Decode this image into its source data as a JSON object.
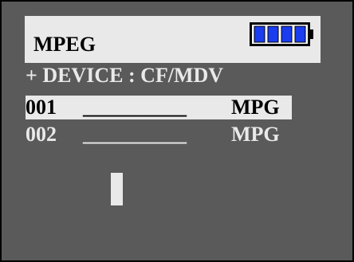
{
  "header": {
    "title": "MPEG",
    "battery_icon": "battery-full-icon",
    "battery_level": 1.0,
    "battery_color": "#1a3df0"
  },
  "device": {
    "label": "+ DEVICE : CF/MDV"
  },
  "files": [
    {
      "number": "001",
      "name": "__________",
      "extension": "MPG",
      "selected": true
    },
    {
      "number": "002",
      "name": "__________",
      "extension": "MPG",
      "selected": false
    }
  ],
  "colors": {
    "screen_background": "#5a5a5a",
    "highlight": "#e9e9e9",
    "text_dark": "#000000",
    "text_light": "#e9e9e9"
  }
}
